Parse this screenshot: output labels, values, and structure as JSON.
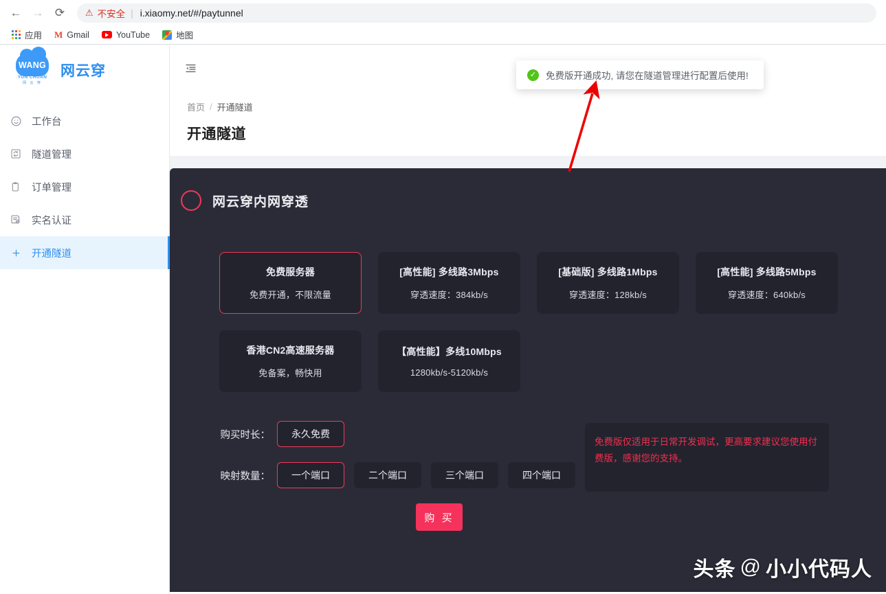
{
  "browser": {
    "back_icon": "back-arrow-icon",
    "forward_icon": "forward-arrow-icon",
    "reload_icon": "reload-icon",
    "security_warning": "不安全",
    "url": "i.xiaomy.net/#/paytunnel",
    "bookmarks": [
      {
        "label": "应用",
        "icon": "apps-grid-icon"
      },
      {
        "label": "Gmail",
        "icon": "gmail-icon"
      },
      {
        "label": "YouTube",
        "icon": "youtube-icon"
      },
      {
        "label": "地图",
        "icon": "google-maps-icon"
      }
    ]
  },
  "sidebar": {
    "logo": {
      "mark_text": "WANG",
      "mark_sub": "YUN CHUAN",
      "mark_sub2": "网 云 穿",
      "brand": "网云穿"
    },
    "items": [
      {
        "label": "工作台",
        "icon": "smiley-face-icon",
        "active": false
      },
      {
        "label": "隧道管理",
        "icon": "tunnel-sync-icon",
        "active": false
      },
      {
        "label": "订单管理",
        "icon": "clipboard-icon",
        "active": false
      },
      {
        "label": "实名认证",
        "icon": "id-verify-icon",
        "active": false
      },
      {
        "label": "开通隧道",
        "icon": "plus-icon",
        "active": true
      }
    ]
  },
  "header": {
    "fold_icon": "menu-fold-icon"
  },
  "toast": {
    "icon": "success-check-icon",
    "message": "免费版开通成功, 请您在隧道管理进行配置后使用!"
  },
  "breadcrumb": {
    "home": "首页",
    "separator": "/",
    "current": "开通隧道"
  },
  "page": {
    "title": "开通隧道"
  },
  "panel": {
    "title": "网云穿内网穿透",
    "ring_color": "#f2385a",
    "background": "#2b2b37",
    "card_background": "#23232e",
    "plans": [
      {
        "name": "免费服务器",
        "desc": "免费开通，不限流量",
        "selected": true
      },
      {
        "name": "[高性能] 多线路3Mbps",
        "desc": "穿透速度：384kb/s",
        "selected": false
      },
      {
        "name": "[基础版] 多线路1Mbps",
        "desc": "穿透速度：128kb/s",
        "selected": false
      },
      {
        "name": "[高性能] 多线路5Mbps",
        "desc": "穿透速度：640kb/s",
        "selected": false
      },
      {
        "name": "香港CN2高速服务器",
        "desc": "免备案，畅快用",
        "selected": false
      },
      {
        "name": "【高性能】多线10Mbps",
        "desc": "1280kb/s-5120kb/s",
        "selected": false
      }
    ],
    "duration": {
      "label": "购买时长：",
      "options": [
        {
          "label": "永久免费",
          "selected": true
        }
      ]
    },
    "ports": {
      "label": "映射数量：",
      "options": [
        {
          "label": "一个端口",
          "selected": true
        },
        {
          "label": "二个端口",
          "selected": false
        },
        {
          "label": "三个端口",
          "selected": false
        },
        {
          "label": "四个端口",
          "selected": false
        }
      ]
    },
    "note": "免费版仅适用于日常开发调试，更高要求建议您使用付费版，感谢您的支持。",
    "note_color": "#f12f4f",
    "buy_button": "购 买",
    "buy_button_color": "#f5325b"
  },
  "watermark": {
    "prefix": "头条",
    "at": "@",
    "handle": "小小代码人"
  },
  "annotation": {
    "arrow_color": "#ee0000"
  }
}
